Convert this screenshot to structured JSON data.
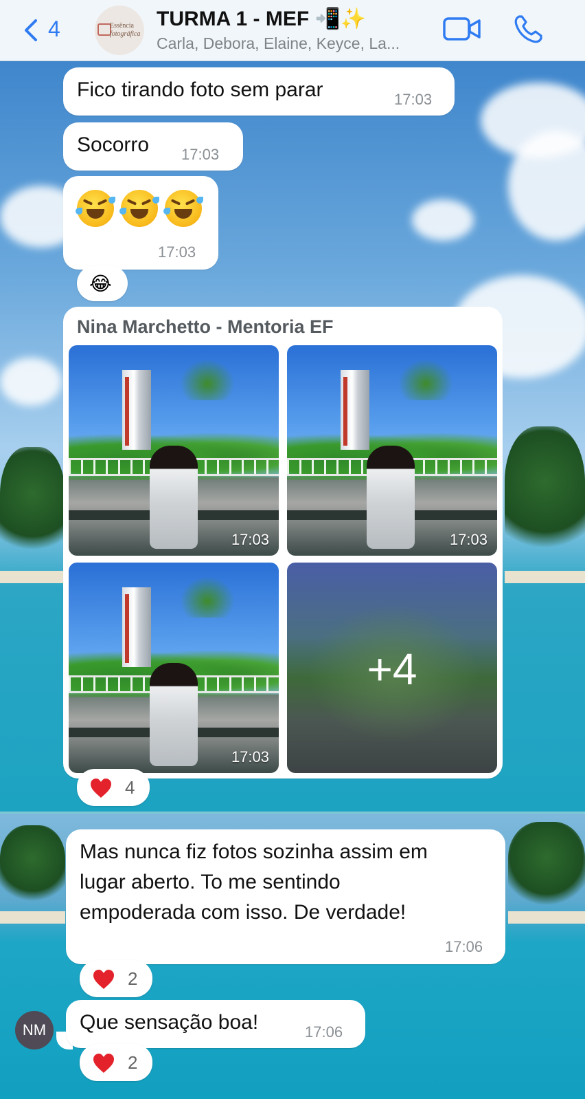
{
  "header": {
    "back_count": "4",
    "avatar_line1": "Essência",
    "avatar_line2": "fotográfica",
    "title": "TURMA 1 - MEF 📲✨",
    "subtitle": "Carla, Debora, Elaine, Keyce, La..."
  },
  "messages": [
    {
      "text": "Fico tirando foto sem parar",
      "time": "17:03"
    },
    {
      "text": "Socorro",
      "time": "17:03"
    },
    {
      "emojis": [
        "rofl",
        "rofl",
        "rofl"
      ],
      "time": "17:03",
      "reaction": "😂"
    }
  ],
  "album": {
    "sender": "Nina Marchetto - Mentoria EF",
    "photos": [
      {
        "time": "17:03"
      },
      {
        "time": "17:03"
      },
      {
        "time": "17:03"
      }
    ],
    "more": "+4",
    "reaction_count": "4"
  },
  "message_long": {
    "line1": "Mas nunca fiz fotos sozinha assim em",
    "line2": "lugar aberto. To me sentindo",
    "line3": "empoderada com isso. De verdade!",
    "time": "17:06",
    "reaction_count": "2"
  },
  "message_short": {
    "avatar": "NM",
    "text": "Que sensação boa!",
    "time": "17:06",
    "reaction_count": "2"
  },
  "icons": {
    "back": "chevron-left-icon",
    "video": "video-camera-icon",
    "phone": "phone-icon",
    "heart": "red-heart-icon"
  },
  "colors": {
    "accent": "#2f7bf2",
    "heart": "#e3222b",
    "bubble": "#ffffff"
  }
}
